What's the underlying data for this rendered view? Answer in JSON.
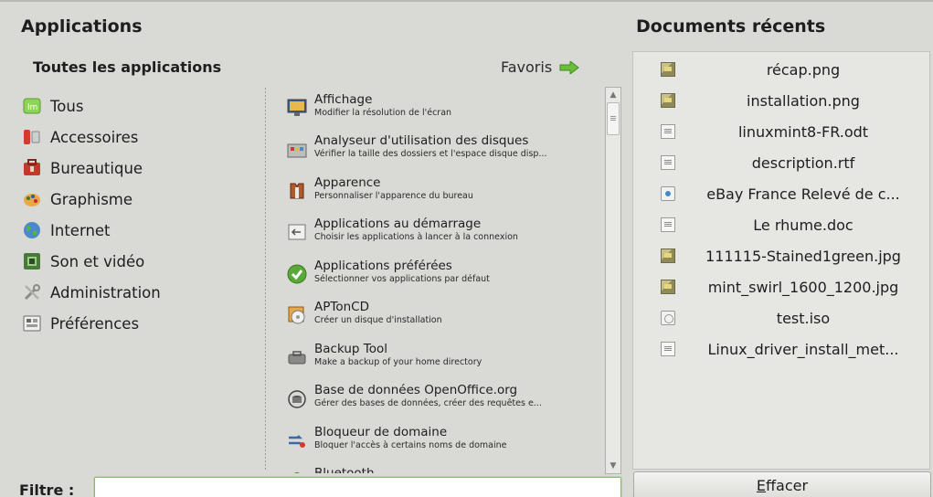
{
  "applications": {
    "title": "Applications",
    "all_apps_label": "Toutes les applications",
    "favoris_label": "Favoris",
    "categories": [
      {
        "label": "Tous",
        "icon": "mint-logo-icon"
      },
      {
        "label": "Accessoires",
        "icon": "accessories-icon"
      },
      {
        "label": "Bureautique",
        "icon": "office-icon"
      },
      {
        "label": "Graphisme",
        "icon": "graphics-icon"
      },
      {
        "label": "Internet",
        "icon": "globe-icon"
      },
      {
        "label": "Son et vidéo",
        "icon": "multimedia-icon"
      },
      {
        "label": "Administration",
        "icon": "tools-icon"
      },
      {
        "label": "Préférences",
        "icon": "preferences-icon"
      }
    ],
    "apps": [
      {
        "name": "Affichage",
        "desc": "Modifier la résolution de l'écran",
        "icon": "display-icon"
      },
      {
        "name": "Analyseur d'utilisation des disques",
        "desc": "Vérifier la taille des dossiers et l'espace disque disp...",
        "icon": "disk-analyzer-icon"
      },
      {
        "name": "Apparence",
        "desc": "Personnaliser l'apparence du bureau",
        "icon": "appearance-icon"
      },
      {
        "name": "Applications au démarrage",
        "desc": "Choisir les applications à lancer à la connexion",
        "icon": "startup-icon"
      },
      {
        "name": "Applications préférées",
        "desc": "Sélectionner vos applications par défaut",
        "icon": "check-icon"
      },
      {
        "name": "APTonCD",
        "desc": "Créer un disque d'installation",
        "icon": "cd-icon"
      },
      {
        "name": "Backup Tool",
        "desc": "Make a backup of your home directory",
        "icon": "backup-icon"
      },
      {
        "name": "Base de données OpenOffice.org",
        "desc": "Gérer des bases de données, créer des requêtes e...",
        "icon": "database-icon"
      },
      {
        "name": "Bloqueur de domaine",
        "desc": "Bloquer l'accès à certains noms de domaine",
        "icon": "domain-blocker-icon"
      },
      {
        "name": "Bluetooth",
        "desc": "",
        "icon": "bluetooth-icon"
      }
    ],
    "filter_label": "Filtre :",
    "filter_value": ""
  },
  "documents": {
    "title": "Documents récents",
    "items": [
      {
        "name": "récap.png",
        "icon": "image-file-icon"
      },
      {
        "name": "installation.png",
        "icon": "image-file-icon"
      },
      {
        "name": "linuxmint8-FR.odt",
        "icon": "text-file-icon"
      },
      {
        "name": "description.rtf",
        "icon": "text-file-icon"
      },
      {
        "name": "eBay France Relevé de c...",
        "icon": "web-file-icon"
      },
      {
        "name": "Le rhume.doc",
        "icon": "text-file-icon"
      },
      {
        "name": "111115-Stained1green.jpg",
        "icon": "image-file-icon"
      },
      {
        "name": "mint_swirl_1600_1200.jpg",
        "icon": "image-file-icon"
      },
      {
        "name": "test.iso",
        "icon": "disc-image-icon"
      },
      {
        "name": "Linux_driver_install_met...",
        "icon": "text-file-icon"
      }
    ],
    "clear_button": {
      "underlined": "E",
      "rest": "ffacer"
    }
  },
  "colors": {
    "background": "#d9d9d5",
    "list_background": "#e6e6e3",
    "favoris_arrow": "#6bbf3a",
    "filter_border": "#8bb57a"
  }
}
